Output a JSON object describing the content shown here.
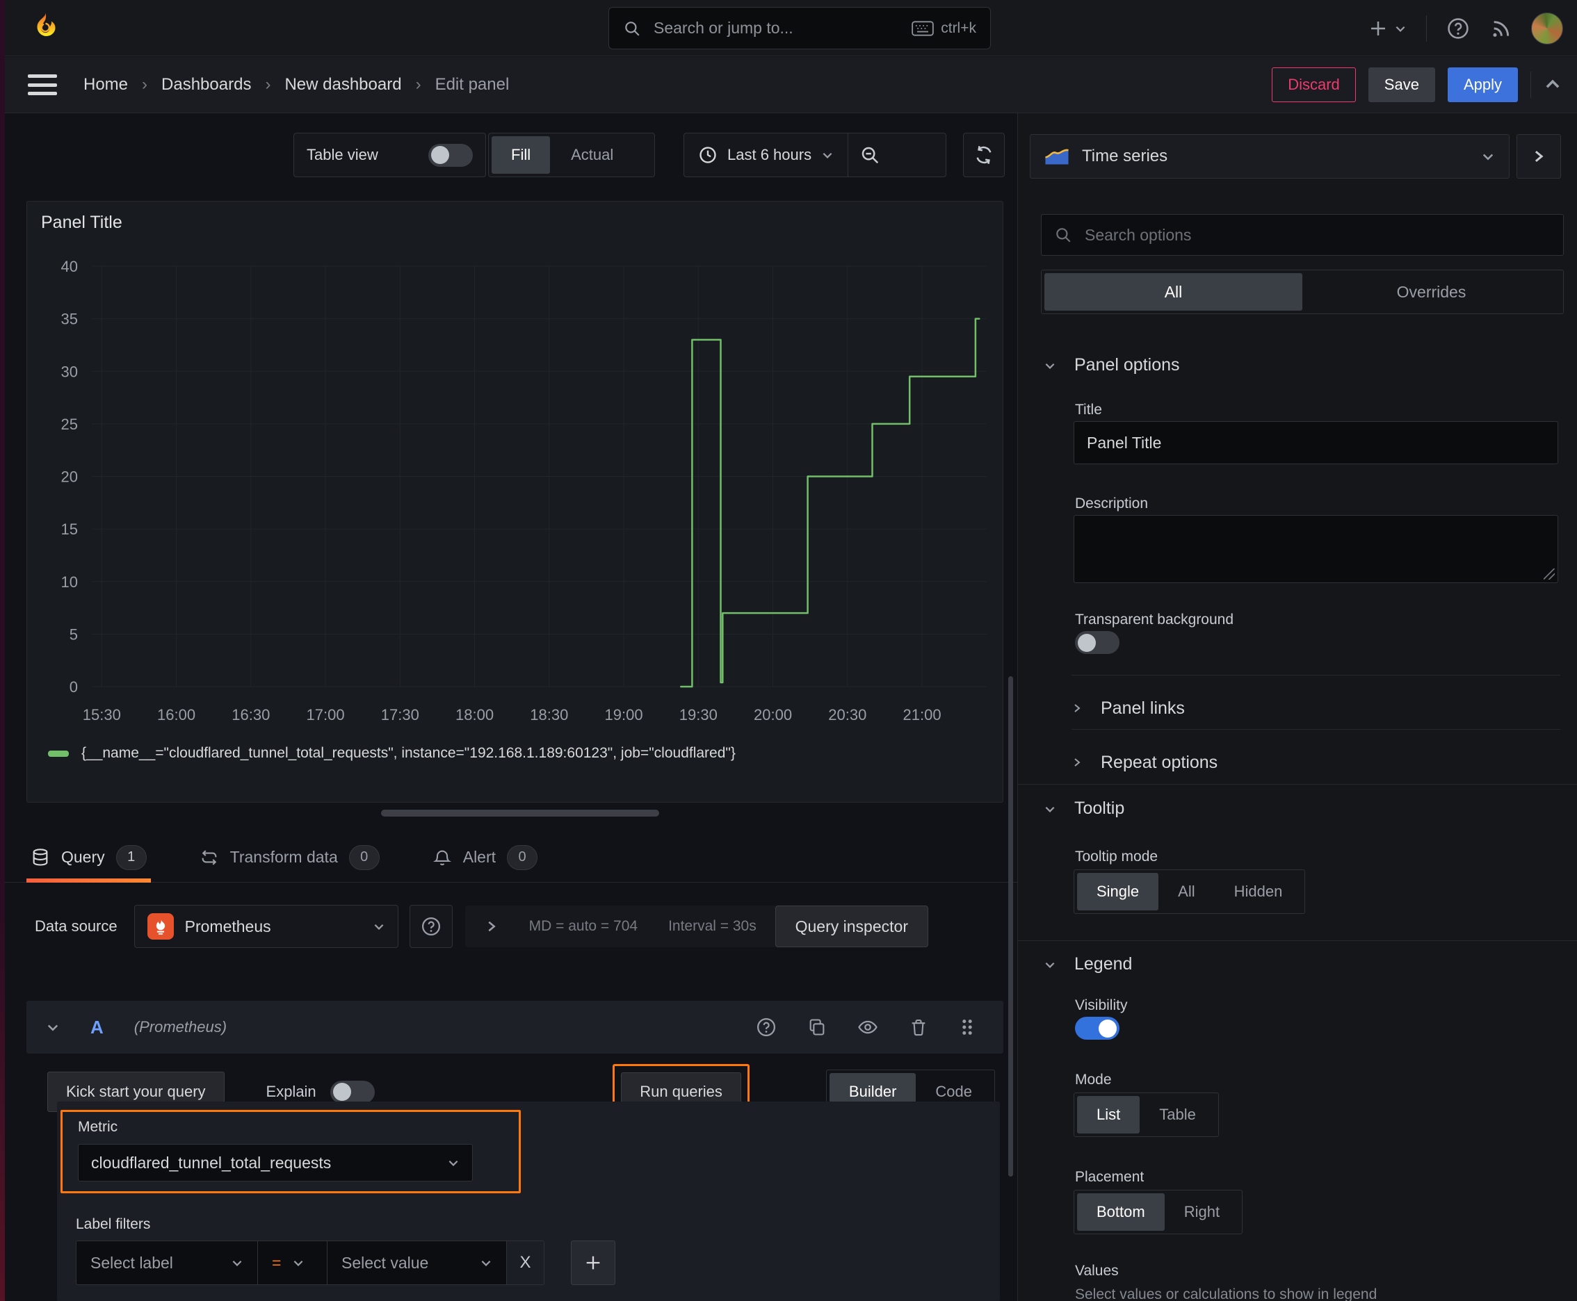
{
  "topbar": {
    "search_placeholder": "Search or jump to...",
    "search_shortcut": "ctrl+k"
  },
  "breadcrumb": {
    "items": [
      "Home",
      "Dashboards",
      "New dashboard",
      "Edit panel"
    ],
    "discard_label": "Discard",
    "save_label": "Save",
    "apply_label": "Apply"
  },
  "panel_toolbar": {
    "table_view_label": "Table view",
    "fill_label": "Fill",
    "actual_label": "Actual",
    "time_range_label": "Last 6 hours"
  },
  "chart_data": {
    "type": "line",
    "title": "Panel Title",
    "xlabel": "",
    "ylabel": "",
    "x_range_minutes": [
      926,
      1286
    ],
    "x_ticks": [
      {
        "m": 930,
        "label": "15:30"
      },
      {
        "m": 960,
        "label": "16:00"
      },
      {
        "m": 990,
        "label": "16:30"
      },
      {
        "m": 1020,
        "label": "17:00"
      },
      {
        "m": 1050,
        "label": "17:30"
      },
      {
        "m": 1080,
        "label": "18:00"
      },
      {
        "m": 1110,
        "label": "18:30"
      },
      {
        "m": 1140,
        "label": "19:00"
      },
      {
        "m": 1170,
        "label": "19:30"
      },
      {
        "m": 1200,
        "label": "20:00"
      },
      {
        "m": 1230,
        "label": "20:30"
      },
      {
        "m": 1260,
        "label": "21:00"
      }
    ],
    "y_range": [
      0,
      40
    ],
    "y_ticks": [
      0,
      5,
      10,
      15,
      20,
      25,
      30,
      35,
      40
    ],
    "grid": true,
    "legend_position": "bottom",
    "series": [
      {
        "name": "{__name__=\"cloudflared_tunnel_total_requests\", instance=\"192.168.1.189:60123\", job=\"cloudflared\"}",
        "color": "#73BF69",
        "points": [
          [
            1163,
            0
          ],
          [
            1167.5,
            0
          ],
          [
            1167.5,
            33
          ],
          [
            1179,
            33
          ],
          [
            1179,
            0.4
          ],
          [
            1179.8,
            0.4
          ],
          [
            1179.8,
            7
          ],
          [
            1214,
            7
          ],
          [
            1214,
            20
          ],
          [
            1240,
            20
          ],
          [
            1240,
            25
          ],
          [
            1255,
            25
          ],
          [
            1255,
            29.5
          ],
          [
            1281.5,
            29.5
          ],
          [
            1281.5,
            35
          ],
          [
            1283,
            35
          ]
        ]
      }
    ]
  },
  "tabs": {
    "query": {
      "label": "Query",
      "count": "1"
    },
    "transform": {
      "label": "Transform data",
      "count": "0"
    },
    "alert": {
      "label": "Alert",
      "count": "0"
    }
  },
  "datasource_row": {
    "label": "Data source",
    "value": "Prometheus",
    "stats_md": "MD = auto = 704",
    "stats_interval": "Interval = 30s",
    "query_inspector_label": "Query inspector"
  },
  "query_editor": {
    "ref_id": "A",
    "ds_name": "(Prometheus)",
    "kick_start_label": "Kick start your query",
    "explain_label": "Explain",
    "run_queries_label": "Run queries",
    "builder_label": "Builder",
    "code_label": "Code",
    "metric_label": "Metric",
    "metric_value": "cloudflared_tunnel_total_requests",
    "label_filters_label": "Label filters",
    "select_label_placeholder": "Select label",
    "operator": "=",
    "select_value_placeholder": "Select value",
    "remove_filter": "X"
  },
  "sidebar": {
    "viz_type": "Time series",
    "search_placeholder": "Search options",
    "filter_all": "All",
    "filter_overrides": "Overrides",
    "panel_options": {
      "header": "Panel options",
      "title_label": "Title",
      "title_value": "Panel Title",
      "description_label": "Description",
      "transparent_label": "Transparent background",
      "panel_links_label": "Panel links",
      "repeat_options_label": "Repeat options"
    },
    "tooltip": {
      "header": "Tooltip",
      "mode_label": "Tooltip mode",
      "modes": [
        "Single",
        "All",
        "Hidden"
      ]
    },
    "legend": {
      "header": "Legend",
      "visibility_label": "Visibility",
      "mode_label": "Mode",
      "modes": [
        "List",
        "Table"
      ],
      "placement_label": "Placement",
      "placements": [
        "Bottom",
        "Right"
      ],
      "values_label": "Values",
      "values_hint": "Select values or calculations to show in legend"
    }
  },
  "colors": {
    "accent_orange": "#FF780A",
    "apply_blue": "#3D71DC",
    "discard_red": "#EF3A6D",
    "series_green": "#73BF69",
    "toggle_blue": "#3371DC"
  }
}
